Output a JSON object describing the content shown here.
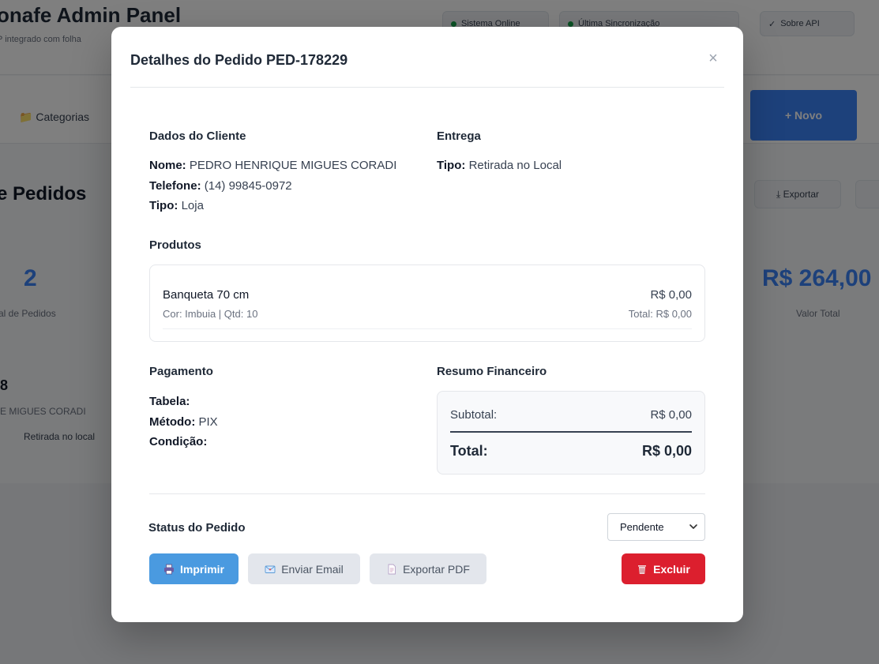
{
  "background": {
    "brand_title": "onafe Admin Panel",
    "brand_subtitle": "P integrado com folha",
    "status_pills": [
      "Sistema Online",
      "Última Sincronização"
    ],
    "top_action": "Sobre API",
    "nav_tab": "Categorias",
    "new_button": "Novo",
    "section_heading": "e Pedidos",
    "export_button": "Exportar",
    "stat_count": "2",
    "stat_count_label": "al de Pedidos",
    "stat_value": "R$ 264,00",
    "stat_value_label": "Valor Total",
    "row_title": "8",
    "row_client": "E MIGUES CORADI",
    "row_detail": "Retirada no local"
  },
  "modal": {
    "title": "Detalhes do Pedido PED-178229",
    "close_glyph": "×",
    "customer": {
      "heading": "Dados do Cliente",
      "name_label": "Nome:",
      "name": "PEDRO HENRIQUE MIGUES CORADI",
      "phone_label": "Telefone:",
      "phone": "(14) 99845-0972",
      "type_label": "Tipo:",
      "type": "Loja"
    },
    "delivery": {
      "heading": "Entrega",
      "type_label": "Tipo:",
      "type": "Retirada no Local"
    },
    "products": {
      "heading": "Produtos",
      "items": [
        {
          "name": "Banqueta 70 cm",
          "meta": "Cor: Imbuia | Qtd: 10",
          "price": "R$ 0,00",
          "total": "Total: R$ 0,00"
        }
      ]
    },
    "payment": {
      "heading": "Pagamento",
      "table_label": "Tabela:",
      "table": "",
      "method_label": "Método:",
      "method": "PIX",
      "condition_label": "Condição:",
      "condition": ""
    },
    "financial": {
      "heading": "Resumo Financeiro",
      "subtotal_label": "Subtotal:",
      "subtotal": "R$ 0,00",
      "total_label": "Total:",
      "total": "R$ 0,00"
    },
    "status": {
      "heading": "Status do Pedido",
      "selected": "Pendente"
    },
    "actions": {
      "print": "Imprimir",
      "email": "Enviar Email",
      "pdf": "Exportar PDF",
      "delete": "Excluir"
    },
    "colors": {
      "primary": "#4a9ae0",
      "danger": "#dc1f2e",
      "neutral": "#e3e6ec"
    }
  }
}
